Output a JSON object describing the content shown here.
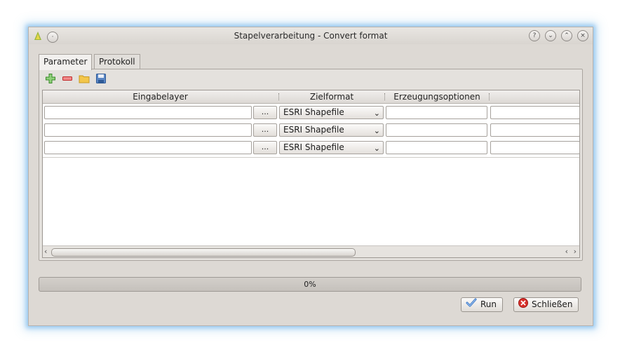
{
  "window": {
    "title": "Stapelverarbeitung - Convert format",
    "controls": [
      "?",
      "⌄",
      "⌃",
      "×"
    ]
  },
  "tabs": [
    {
      "label": "Parameter",
      "active": true
    },
    {
      "label": "Protokoll",
      "active": false
    }
  ],
  "toolbar": {
    "icons": [
      "add-row-icon",
      "remove-row-icon",
      "open-folder-icon",
      "save-icon"
    ]
  },
  "table": {
    "columns": [
      "Eingabelayer",
      "Zielformat",
      "Erzeugungsoptionen",
      ""
    ],
    "browse_label": "...",
    "rows": [
      {
        "input": "",
        "format": "ESRI Shapefile",
        "options": "",
        "extra": ""
      },
      {
        "input": "",
        "format": "ESRI Shapefile",
        "options": "",
        "extra": ""
      },
      {
        "input": "",
        "format": "ESRI Shapefile",
        "options": "",
        "extra": ""
      }
    ]
  },
  "progress": {
    "label": "0%",
    "value": 0
  },
  "buttons": {
    "run_label": "Run",
    "close_label": "Schließen"
  },
  "colors": {
    "window_bg": "#ddd9d4",
    "focus_glow": "#5caae8",
    "close_icon_red": "#d8302a",
    "run_check_blue": "#3a78c9"
  }
}
